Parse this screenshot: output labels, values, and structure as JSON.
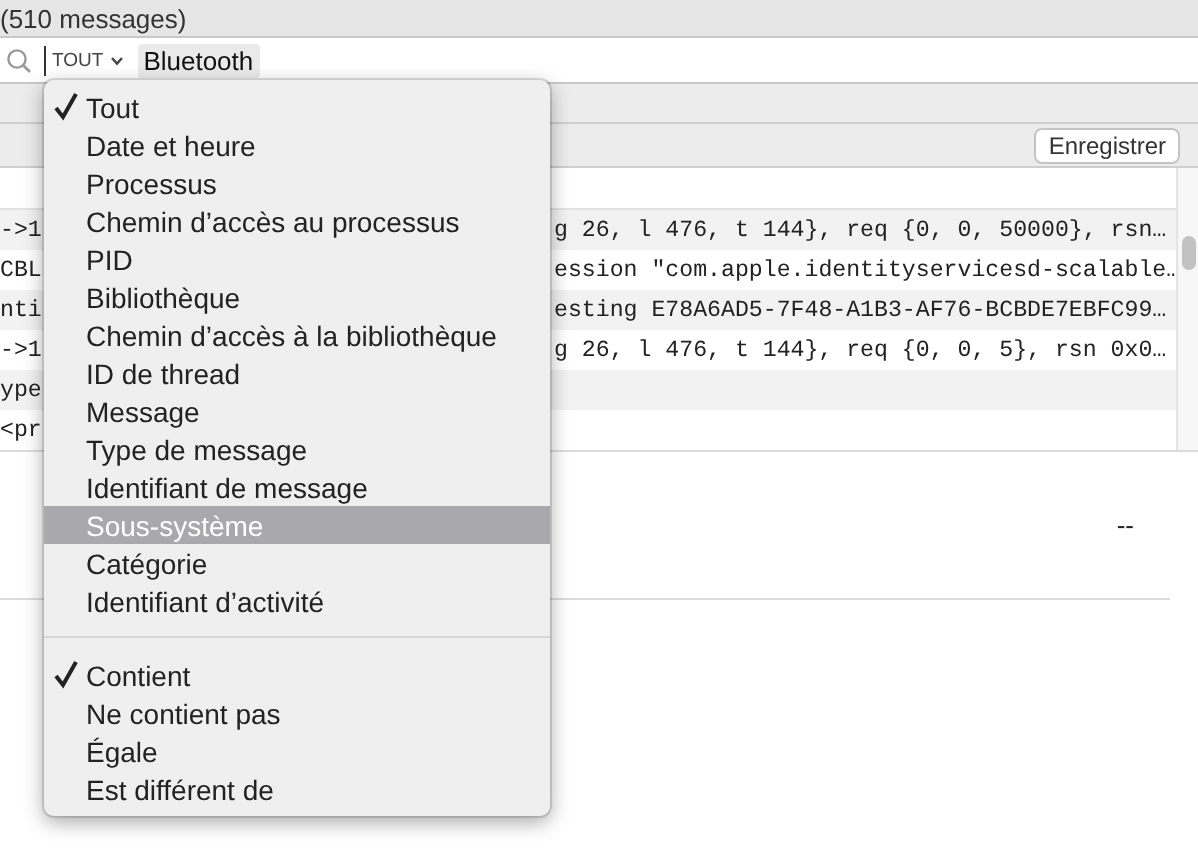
{
  "window": {
    "title": "(510 messages)"
  },
  "search": {
    "scope": "TOUT",
    "token": "Bluetooth"
  },
  "toolbar": {
    "button": "Enregistrer"
  },
  "log_rows": [
    {
      "left": "->1",
      "right": "g 26, l 476, t 144}, req {0, 0, 50000}, rsn…"
    },
    {
      "left": "CBL",
      "right": "ession \"com.apple.identityservicesd-scalable…"
    },
    {
      "left": "nti",
      "right": "esting E78A6AD5-7F48-A1B3-AF76-BCBDE7EBFC99…"
    },
    {
      "left": "->1",
      "right": "g 26, l 476, t 144}, req {0, 0, 5}, rsn 0x0…"
    },
    {
      "left": "ype",
      "right": ""
    },
    {
      "left": "<pr",
      "right": ""
    }
  ],
  "detail": {
    "value": "--"
  },
  "menu": {
    "sections": [
      {
        "items": [
          {
            "label": "Tout",
            "checked": true,
            "highlighted": false
          },
          {
            "label": "Date et heure",
            "checked": false,
            "highlighted": false
          },
          {
            "label": "Processus",
            "checked": false,
            "highlighted": false
          },
          {
            "label": "Chemin d’accès au processus",
            "checked": false,
            "highlighted": false
          },
          {
            "label": "PID",
            "checked": false,
            "highlighted": false
          },
          {
            "label": "Bibliothèque",
            "checked": false,
            "highlighted": false
          },
          {
            "label": "Chemin d’accès à la bibliothèque",
            "checked": false,
            "highlighted": false
          },
          {
            "label": "ID de thread",
            "checked": false,
            "highlighted": false
          },
          {
            "label": "Message",
            "checked": false,
            "highlighted": false
          },
          {
            "label": "Type de message",
            "checked": false,
            "highlighted": false
          },
          {
            "label": "Identifiant de message",
            "checked": false,
            "highlighted": false
          },
          {
            "label": "Sous-système",
            "checked": false,
            "highlighted": true
          },
          {
            "label": "Catégorie",
            "checked": false,
            "highlighted": false
          },
          {
            "label": "Identifiant d’activité",
            "checked": false,
            "highlighted": false
          }
        ]
      },
      {
        "items": [
          {
            "label": "Contient",
            "checked": true,
            "highlighted": false
          },
          {
            "label": "Ne contient pas",
            "checked": false,
            "highlighted": false
          },
          {
            "label": "Égale",
            "checked": false,
            "highlighted": false
          },
          {
            "label": "Est différent de",
            "checked": false,
            "highlighted": false
          }
        ]
      }
    ]
  }
}
